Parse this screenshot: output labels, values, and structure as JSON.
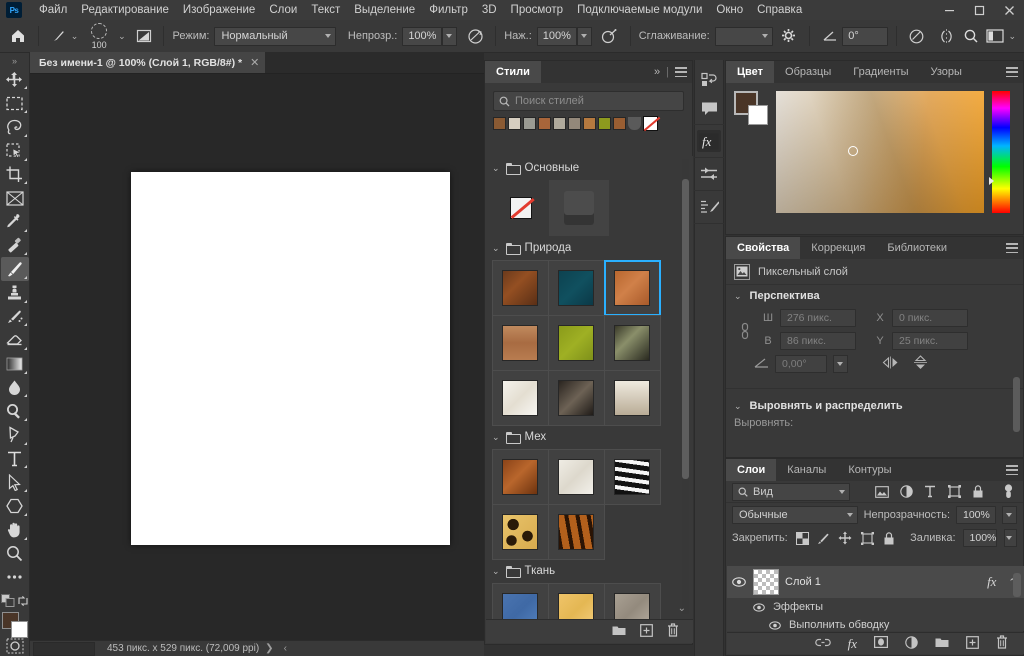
{
  "app": {
    "logo": "Ps"
  },
  "menu": {
    "items": [
      "Файл",
      "Редактирование",
      "Изображение",
      "Слои",
      "Текст",
      "Выделение",
      "Фильтр",
      "3D",
      "Просмотр",
      "Подключаемые модули",
      "Окно",
      "Справка"
    ]
  },
  "window_controls": {
    "minimize": "—",
    "maximize": "❐",
    "close": "✕"
  },
  "options_bar": {
    "home_icon": "home-icon",
    "brush_preset_icon": "brush-icon",
    "brush_size": "100",
    "toggle_panel_icon": "brush-panel-icon",
    "mode_label": "Режим:",
    "mode_value": "Нормальный",
    "opacity_label": "Непрозр.:",
    "opacity_value": "100%",
    "pressure_opacity_icon": "pressure-opacity-icon",
    "flow_label": "Наж.:",
    "flow_value": "100%",
    "airbrush_icon": "airbrush-icon",
    "smoothing_label": "Сглаживание:",
    "smoothing_value": "",
    "smoothing_options_icon": "gear-icon",
    "angle_icon": "angle-icon",
    "angle_value": "0°",
    "pressure_size_icon": "pressure-size-icon",
    "symmetry_icon": "symmetry-icon",
    "search_icon": "search-icon",
    "workspace_icon": "workspace-icon"
  },
  "toolbar": {
    "collapse_icon": "double-chevron-icon",
    "tools": [
      {
        "name": "move-tool",
        "icon": "move-icon",
        "active": false,
        "has_flyout": true
      },
      {
        "name": "rectangular-marquee-tool",
        "icon": "marquee-icon",
        "active": false,
        "has_flyout": true
      },
      {
        "name": "lasso-tool",
        "icon": "lasso-icon",
        "active": false,
        "has_flyout": true
      },
      {
        "name": "object-selection-tool",
        "icon": "object-selection-icon",
        "active": false,
        "has_flyout": true
      },
      {
        "name": "crop-tool",
        "icon": "crop-icon",
        "active": false,
        "has_flyout": true
      },
      {
        "name": "frame-tool",
        "icon": "frame-icon",
        "active": false,
        "has_flyout": false
      },
      {
        "name": "eyedropper-tool",
        "icon": "eyedropper-icon",
        "active": false,
        "has_flyout": true
      },
      {
        "name": "healing-brush-tool",
        "icon": "healing-brush-icon",
        "active": false,
        "has_flyout": true
      },
      {
        "name": "brush-tool",
        "icon": "brush-icon",
        "active": true,
        "has_flyout": true
      },
      {
        "name": "clone-stamp-tool",
        "icon": "clone-stamp-icon",
        "active": false,
        "has_flyout": true
      },
      {
        "name": "history-brush-tool",
        "icon": "history-brush-icon",
        "active": false,
        "has_flyout": true
      },
      {
        "name": "eraser-tool",
        "icon": "eraser-icon",
        "active": false,
        "has_flyout": true
      },
      {
        "name": "gradient-tool",
        "icon": "gradient-icon",
        "active": false,
        "has_flyout": true
      },
      {
        "name": "blur-tool",
        "icon": "blur-icon",
        "active": false,
        "has_flyout": true
      },
      {
        "name": "dodge-tool",
        "icon": "dodge-icon",
        "active": false,
        "has_flyout": true
      },
      {
        "name": "pen-tool",
        "icon": "pen-icon",
        "active": false,
        "has_flyout": true
      },
      {
        "name": "type-tool",
        "icon": "type-icon",
        "active": false,
        "has_flyout": true
      },
      {
        "name": "path-selection-tool",
        "icon": "path-selection-icon",
        "active": false,
        "has_flyout": true
      },
      {
        "name": "shape-tool",
        "icon": "polygon-icon",
        "active": false,
        "has_flyout": true
      },
      {
        "name": "hand-tool",
        "icon": "hand-icon",
        "active": false,
        "has_flyout": true
      },
      {
        "name": "zoom-tool",
        "icon": "magnifier-icon",
        "active": false,
        "has_flyout": false
      },
      {
        "name": "edit-toolbar",
        "icon": "ellipsis-icon",
        "active": false,
        "has_flyout": false
      }
    ],
    "default_colors_icon": "default-colors-icon",
    "swap_colors_icon": "swap-colors-icon",
    "foreground_color": "#4a3527",
    "background_color": "#ffffff",
    "quick_mask_icon": "quick-mask-icon"
  },
  "document": {
    "tab_title": "Без имени-1 @ 100% (Слой 1, RGB/8#) *",
    "close_icon": "close-icon"
  },
  "status_bar": {
    "zoom_value": "",
    "dimensions": "453 пикс. x 529 пикс. (72,009 ppi)",
    "expand_icon": "chevron-right-icon"
  },
  "styles_panel": {
    "tabs": [
      {
        "label": "Стили",
        "active": true
      }
    ],
    "collapse_icon": "double-chevron-right-icon",
    "menu_icon": "panel-menu-icon",
    "search": {
      "icon": "search-icon",
      "placeholder": "Поиск стилей",
      "value": ""
    },
    "filter_swatches": [
      "#8a5a33",
      "#d6cec0",
      "#9b9b93",
      "#a8653a",
      "#b0aa9c",
      "#93887a",
      "#b5793f",
      "#8d9a1e",
      "#9a5e32"
    ],
    "filter_none_icon": "no-style-icon",
    "groups": [
      {
        "name": "Основные",
        "folder_icon": "folder-icon",
        "chevron": "⌄",
        "swatches": [
          {
            "name": "none",
            "type": "none"
          },
          {
            "name": "default",
            "type": "default"
          }
        ]
      },
      {
        "name": "Природа",
        "folder_icon": "folder-icon",
        "chevron": "⌄",
        "swatches": [
          {
            "name": "bark",
            "css": "linear-gradient(135deg,#6b3a1c,#944f22 40%,#5a2f16)"
          },
          {
            "name": "deep-water",
            "css": "linear-gradient(135deg,#0d4250,#10505f 50%,#0b3947)"
          },
          {
            "name": "rust",
            "css": "linear-gradient(135deg,#b9672f,#d08049 45%,#a85a2a)",
            "selected": true
          },
          {
            "name": "brick",
            "css": "linear-gradient(180deg,#c08a5e,#a86b42 50%,#b87c50)"
          },
          {
            "name": "grass",
            "css": "linear-gradient(135deg,#8a9b1a,#9fb024 50%,#7e901a)"
          },
          {
            "name": "foliage",
            "css": "linear-gradient(135deg,#3a3a2a,#8a8f6a 40%,#2a2a20)"
          },
          {
            "name": "marble",
            "css": "linear-gradient(135deg,#f4f2ec,#e4ded1 50%,#f7f6f2)"
          },
          {
            "name": "speckle",
            "css": "linear-gradient(135deg,#2a2520,#6d6255 50%,#201c18)"
          },
          {
            "name": "sand-cone",
            "css": "linear-gradient(180deg,#efeadf,#b9ac96)"
          }
        ]
      },
      {
        "name": "Мех",
        "folder_icon": "folder-icon",
        "chevron": "⌄",
        "swatches": [
          {
            "name": "copper-fur",
            "css": "linear-gradient(135deg,#8a4318,#b9662c 45%,#6e330f)"
          },
          {
            "name": "white-fur",
            "css": "linear-gradient(135deg,#efece4,#ddd8cc 50%,#f2f0ea)"
          },
          {
            "name": "zebra",
            "css": "repeating-linear-gradient(8deg,#111 0 5px,#f5f5f5 5px 9px)"
          },
          {
            "name": "leopard",
            "css": "radial-gradient(circle at 30% 30%,#2a1a08 14%,transparent 15%), radial-gradient(circle at 70% 60%,#2a1a08 14%,transparent 15%), linear-gradient(135deg,#e8c36a,#d8ab4e)"
          },
          {
            "name": "tiger",
            "css": "repeating-linear-gradient(80deg,#2a1405 0 4px,#b3601c 4px 11px)"
          }
        ]
      },
      {
        "name": "Ткань",
        "folder_icon": "folder-icon",
        "chevron": "⌄",
        "swatches": [
          {
            "name": "denim",
            "css": "linear-gradient(135deg,#4a74b0,#3f69a5 50%,#5280bd)"
          },
          {
            "name": "burlap",
            "css": "linear-gradient(135deg,#efc469,#e4b753 50%,#f3cd7c)"
          },
          {
            "name": "linen",
            "css": "linear-gradient(135deg,#a9a093,#938a7d 50%,#b4ab9e)"
          }
        ]
      }
    ],
    "footer": {
      "new_group_icon": "folder-icon",
      "new_style_icon": "new-item-icon",
      "delete_icon": "trash-icon"
    },
    "scroll_down_icon": "chevron-down-icon"
  },
  "icon_rail": {
    "buttons": [
      {
        "name": "history-panel-button",
        "icon": "history-icon",
        "active": false
      },
      {
        "name": "comments-panel-button",
        "icon": "comment-icon",
        "active": false
      },
      {
        "name": "layer-styles-button",
        "icon": "fx-icon",
        "active": true
      },
      {
        "name": "adjustments-panel-button",
        "icon": "sliders-icon",
        "active": false
      },
      {
        "name": "brush-settings-button",
        "icon": "brush-settings-icon",
        "active": false
      }
    ]
  },
  "color_panel": {
    "tabs": [
      {
        "label": "Цвет",
        "active": true
      },
      {
        "label": "Образцы",
        "active": false
      },
      {
        "label": "Градиенты",
        "active": false
      },
      {
        "label": "Узоры",
        "active": false
      }
    ],
    "menu_icon": "panel-menu-icon",
    "foreground_color": "#4a3527",
    "background_color": "#ffffff",
    "spectrum_name": "color-spectrum-field",
    "hue_strip_name": "hue-strip"
  },
  "properties_panel": {
    "tabs": [
      {
        "label": "Свойства",
        "active": true
      },
      {
        "label": "Коррекция",
        "active": false
      },
      {
        "label": "Библиотеки",
        "active": false
      }
    ],
    "menu_icon": "panel-menu-icon",
    "layer_type_icon": "pixel-layer-icon",
    "layer_type": "Пиксельный слой",
    "sections": [
      {
        "title": "Перспектива",
        "chevron": "⌄",
        "link_icon": "link-icon",
        "fields": [
          {
            "label": "Ш",
            "value": "276 пикс."
          },
          {
            "label": "X",
            "value": "0 пикс."
          },
          {
            "label": "В",
            "value": "86 пикс."
          },
          {
            "label": "Y",
            "value": "25 пикс."
          }
        ],
        "angle_icon": "angle-icon",
        "angle_value": "0,00°",
        "flip_h_icon": "flip-horizontal-icon",
        "flip_v_icon": "flip-vertical-icon"
      },
      {
        "title": "Выровнять и распределить",
        "chevron": "⌄",
        "align_label": "Выровнять:"
      }
    ]
  },
  "layers_panel": {
    "tabs": [
      {
        "label": "Слои",
        "active": true
      },
      {
        "label": "Каналы",
        "active": false
      },
      {
        "label": "Контуры",
        "active": false
      }
    ],
    "menu_icon": "panel-menu-icon",
    "filter": {
      "icon": "search-icon",
      "value": "Вид"
    },
    "filter_type_icons": [
      "pixel-filter-icon",
      "adjustment-filter-icon",
      "type-filter-icon",
      "shape-filter-icon",
      "smart-object-filter-icon"
    ],
    "filter_toggle_icon": "filter-toggle-icon",
    "blend_mode": "Обычные",
    "opacity_label": "Непрозрачность:",
    "opacity_value": "100%",
    "lock_label": "Закрепить:",
    "lock_icons": [
      "lock-transparent-icon",
      "lock-image-icon",
      "lock-position-icon",
      "lock-artboard-icon",
      "lock-all-icon"
    ],
    "fill_label": "Заливка:",
    "fill_value": "100%",
    "layers": [
      {
        "name": "Слой 1",
        "visible_icon": "eye-icon",
        "fx_badge": "fx",
        "expand_icon": "chevron-up-icon",
        "children": [
          {
            "name": "Эффекты",
            "visible_icon": "eye-icon"
          },
          {
            "name": "Выполнить обводку",
            "visible_icon": "eye-icon"
          }
        ]
      }
    ],
    "footer": {
      "link_icon": "link-icon",
      "fx_icon": "fx-icon",
      "mask_icon": "mask-icon",
      "adjustment_icon": "adjustment-icon",
      "group_icon": "folder-icon",
      "new_layer_icon": "new-item-icon",
      "delete_icon": "trash-icon"
    }
  }
}
